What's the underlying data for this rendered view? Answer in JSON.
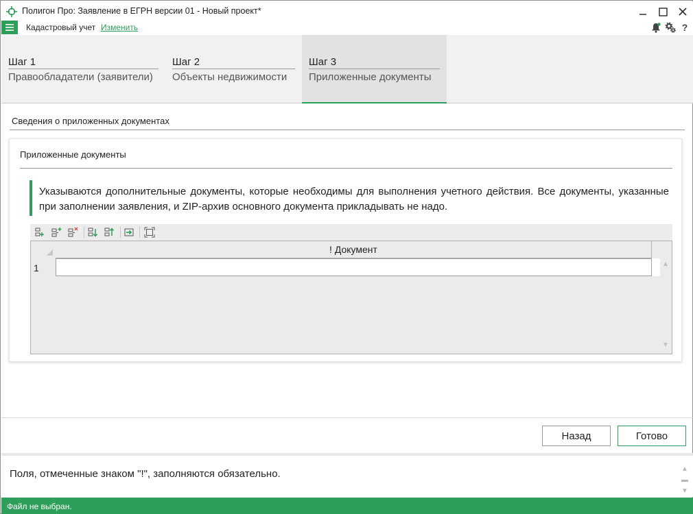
{
  "window": {
    "title": "Полигон Про: Заявление в ЕГРН версии 01 - Новый проект*"
  },
  "menubar": {
    "context_label": "Кадастровый учет",
    "change_link": "Изменить"
  },
  "steps": [
    {
      "number": "Шаг 1",
      "title": "Правообладатели (заявители)",
      "active": false
    },
    {
      "number": "Шаг 2",
      "title": "Объекты недвижимости",
      "active": false
    },
    {
      "number": "Шаг 3",
      "title": "Приложенные документы",
      "active": true
    }
  ],
  "section": {
    "title": "Сведения о приложенных документах"
  },
  "panel": {
    "title": "Приложенные документы",
    "info": "Указываются дополнительные документы, которые необходимы для выполнения учетного действия. Все документы, указанные при заполнении заявления, и ZIP-архив основного документа прикладывать не надо."
  },
  "grid": {
    "column_header": "! Документ",
    "rows": [
      {
        "number": "1",
        "document": ""
      }
    ]
  },
  "buttons": {
    "back": "Назад",
    "done": "Готово"
  },
  "hint": {
    "text": "Поля, отмеченные знаком \"!\", заполняются обязательно."
  },
  "status": {
    "text": "Файл не выбран."
  },
  "colors": {
    "accent": "#2e9e5b",
    "step_bg": "#f1f1f1",
    "active_step_bg": "#e2e2e2"
  },
  "icons": {
    "app": "crosshair-icon",
    "menu": "hamburger-icon",
    "notifications": "bell-icon",
    "settings": "gears-icon",
    "help": "question-icon"
  }
}
